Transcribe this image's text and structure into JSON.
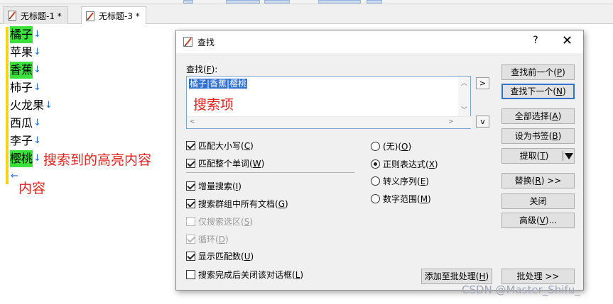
{
  "tabs": [
    {
      "label": "无标题-1 *",
      "active": false
    },
    {
      "label": "无标题-3 *",
      "active": true
    }
  ],
  "editor": {
    "lines": [
      {
        "text": "橘子",
        "highlighted": true
      },
      {
        "text": "苹果",
        "highlighted": false
      },
      {
        "text": "香蕉",
        "highlighted": true
      },
      {
        "text": "柿子",
        "highlighted": false
      },
      {
        "text": "火龙果",
        "highlighted": false
      },
      {
        "text": "西瓜",
        "highlighted": false
      },
      {
        "text": "李子",
        "highlighted": false
      },
      {
        "text": "樱桃",
        "highlighted": true
      }
    ],
    "line_end_glyph": "↓",
    "final_glyph": "←",
    "annotation_highlight": "搜索到的高亮内容",
    "annotation_content": "内容",
    "highlight_color": "#3ce23c",
    "annotation_color": "#e8201c"
  },
  "dialog": {
    "title": "查找",
    "help": "?",
    "close": "✕",
    "find_label": "查找(",
    "find_label_key": "F",
    "find_label_end": "):",
    "find_value": "橘子|香蕉|樱桃",
    "find_annotation": "搜索项",
    "prev_arrow": ">",
    "next_arrow": "v",
    "checkboxes": [
      {
        "pre": "匹配大小写(",
        "key": "C",
        "post": ")",
        "checked": true,
        "disabled": false
      },
      {
        "pre": "匹配整个单词(",
        "key": "W",
        "post": ")",
        "checked": true,
        "disabled": false
      },
      {
        "pre": "增量搜索(",
        "key": "I",
        "post": ")",
        "checked": true,
        "disabled": false
      },
      {
        "pre": "搜索群组中所有文档(",
        "key": "G",
        "post": ")",
        "checked": true,
        "disabled": false
      },
      {
        "pre": "仅搜索选区(",
        "key": "S",
        "post": ")",
        "checked": false,
        "disabled": true
      },
      {
        "pre": "循环(",
        "key": "D",
        "post": ")",
        "checked": true,
        "disabled": true
      },
      {
        "pre": "显示匹配数(",
        "key": "U",
        "post": ")",
        "checked": true,
        "disabled": false
      },
      {
        "pre": "搜索完成后关闭该对话框(",
        "key": "L",
        "post": ")",
        "checked": false,
        "disabled": false
      }
    ],
    "radios": [
      {
        "pre": "(无)(",
        "key": "O",
        "post": ")",
        "selected": false
      },
      {
        "pre": "正则表达式(",
        "key": "X",
        "post": ")",
        "selected": true
      },
      {
        "pre": "转义序列(",
        "key": "E",
        "post": ")",
        "selected": false
      },
      {
        "pre": "数字范围(",
        "key": "M",
        "post": ")",
        "selected": false
      }
    ],
    "buttons": {
      "find_prev": {
        "pre": "查找前一个(",
        "key": "P",
        "post": ")"
      },
      "find_next": {
        "pre": "查找下一个(",
        "key": "N",
        "post": ")"
      },
      "select_all": {
        "pre": "全部选择(",
        "key": "A",
        "post": ")"
      },
      "bookmark": {
        "pre": "设为书签(",
        "key": "B",
        "post": ")"
      },
      "extract": {
        "pre": "提取(",
        "key": "T",
        "post": ")"
      },
      "replace": {
        "pre": "替换(",
        "key": "R",
        "post": ") >>"
      },
      "close": {
        "label": "关闭"
      },
      "advanced": {
        "pre": "高级(",
        "key": "V",
        "post": ")..."
      },
      "add_batch": {
        "pre": "添加至批处理(",
        "key": "H",
        "post": ")"
      },
      "batch": {
        "label": "批处理 >>"
      }
    }
  },
  "watermark": "CSDN @Master_Shifu_"
}
